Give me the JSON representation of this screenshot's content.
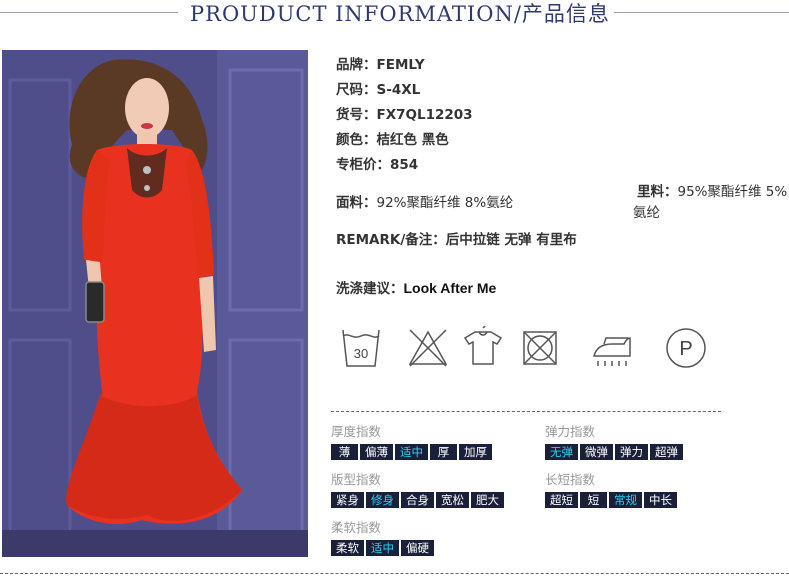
{
  "header": {
    "title": "PROUDUCT INFORMATION/产品信息"
  },
  "colors": {
    "header_text": "#2e3a6e",
    "chip_bg": "#1a1f3a",
    "chip_active_text": "#26d4f0",
    "dress": "#e8321f"
  },
  "info": {
    "brand": {
      "label": "品牌：",
      "value": "FEMLY"
    },
    "size": {
      "label": "尺码：",
      "value": "S-4XL"
    },
    "sku": {
      "label": "货号：",
      "value": "FX7QL12203"
    },
    "color": {
      "label": "颜色：",
      "value": "桔红色  黑色"
    },
    "price": {
      "label": "专柜价：",
      "value": "854"
    },
    "fabric": {
      "label": "面料：",
      "value": "92%聚酯纤维 8%氨纶"
    },
    "lining": {
      "label": "里料：",
      "value_line1": "95%聚酯纤维 5%",
      "value_line2": "氨纶"
    },
    "remark": {
      "label": "REMARK/备注：",
      "value": "后中拉链 无弹 有里布"
    },
    "wash": {
      "label": "洗涤建议：",
      "value": "Look After Me"
    }
  },
  "care_icons": [
    "wash-30-icon",
    "no-bleach-icon",
    "shirt-icon",
    "no-tumble-dry-icon",
    "iron-icon",
    "dry-clean-p-icon"
  ],
  "care_text": {
    "wash_temp": "30",
    "dry_clean": "P"
  },
  "indices": {
    "thickness": {
      "label": "厚度指数",
      "options": [
        "薄",
        "偏薄",
        "适中",
        "厚",
        "加厚"
      ],
      "active": 2
    },
    "elasticity": {
      "label": "弹力指数",
      "options": [
        "无弹",
        "微弹",
        "弹力",
        "超弹"
      ],
      "active": 0
    },
    "fit": {
      "label": "版型指数",
      "options": [
        "紧身",
        "修身",
        "合身",
        "宽松",
        "肥大"
      ],
      "active": 1
    },
    "length": {
      "label": "长短指数",
      "options": [
        "超短",
        "短",
        "常规",
        "中长"
      ],
      "active": 2
    },
    "softness": {
      "label": "柔软指数",
      "options": [
        "柔软",
        "适中",
        "偏硬"
      ],
      "active": 1
    }
  }
}
